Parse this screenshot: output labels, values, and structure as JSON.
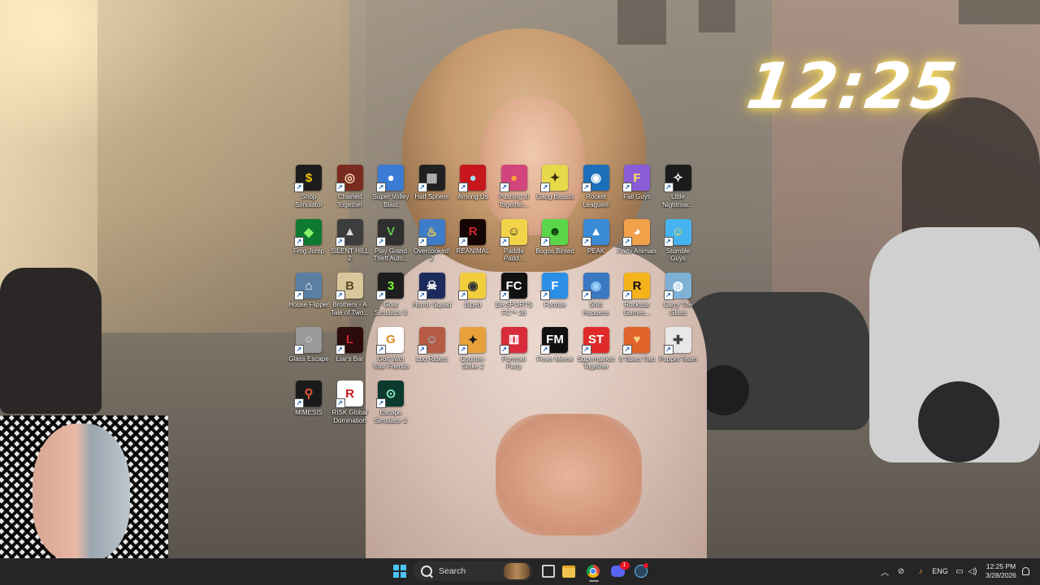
{
  "clock_widget": {
    "time": "12:25"
  },
  "desktop_icons": [
    {
      "label": "Shop Simulator",
      "color": "#1c1c1c",
      "glyph": "$",
      "glyph_color": "#f7c400"
    },
    {
      "label": "Chained Together",
      "color": "#7a2a1e",
      "glyph": "◎",
      "glyph_color": "#f0d9b5"
    },
    {
      "label": "Super Volley Blast",
      "color": "#3a7bd5",
      "glyph": "●",
      "glyph_color": "#ffffff"
    },
    {
      "label": "Half Sphere",
      "color": "#202020",
      "glyph": "▦",
      "glyph_color": "#bdbdbd"
    },
    {
      "label": "Among Us",
      "color": "#c8161d",
      "glyph": "●",
      "glyph_color": "#a7dcef"
    },
    {
      "label": "Pushing it! Together...",
      "color": "#d1457c",
      "glyph": "●",
      "glyph_color": "#f7a03a"
    },
    {
      "label": "Gang Beasts",
      "color": "#e6d94a",
      "glyph": "✦",
      "glyph_color": "#3a2d0c"
    },
    {
      "label": "Rocket League®",
      "color": "#1b6fb8",
      "glyph": "◉",
      "glyph_color": "#ffffff"
    },
    {
      "label": "Fall Guys",
      "color": "#8a5cd6",
      "glyph": "F",
      "glyph_color": "#ffe45c"
    },
    {
      "label": "Little Nightmar...",
      "color": "#1c1c1c",
      "glyph": "✧",
      "glyph_color": "#ffffff"
    },
    {
      "label": "Frog Jump",
      "color": "#0e7a2f",
      "glyph": "◆",
      "glyph_color": "#8bf26a"
    },
    {
      "label": "SILENT HILL 2",
      "color": "#3d3d3d",
      "glyph": "▲",
      "glyph_color": "#d9d9d9"
    },
    {
      "label": "Play Grand Theft Auto...",
      "color": "#2f2f2f",
      "glyph": "V",
      "glyph_color": "#5fc64b"
    },
    {
      "label": "Overcooked! 2",
      "color": "#3f7cc7",
      "glyph": "♨",
      "glyph_color": "#ffcf3f"
    },
    {
      "label": "REANIMAL",
      "color": "#150505",
      "glyph": "R",
      "glyph_color": "#d6242c"
    },
    {
      "label": "Paddle Padd...",
      "color": "#f3d34a",
      "glyph": "☺",
      "glyph_color": "#222222"
    },
    {
      "label": "Bogos Binted",
      "color": "#5bd64a",
      "glyph": "☻",
      "glyph_color": "#0b3d0b"
    },
    {
      "label": "PEAK",
      "color": "#3a8ad6",
      "glyph": "▲",
      "glyph_color": "#ffffff"
    },
    {
      "label": "Party Animals",
      "color": "#f0a14a",
      "glyph": "◕",
      "glyph_color": "#ffffff"
    },
    {
      "label": "Stumble Guys",
      "color": "#46b3f0",
      "glyph": "☺",
      "glyph_color": "#ffde3f"
    },
    {
      "label": "House Flipper",
      "color": "#5b7fa3",
      "glyph": "⌂",
      "glyph_color": "#ffffff"
    },
    {
      "label": "Brothers - A Tale of Two...",
      "color": "#d9c79b",
      "glyph": "B",
      "glyph_color": "#5a4a2a"
    },
    {
      "label": "Goat Simulator 3",
      "color": "#1e1e1e",
      "glyph": "3",
      "glyph_color": "#7dff3a"
    },
    {
      "label": "Horror Squad",
      "color": "#1d2a5c",
      "glyph": "☠",
      "glyph_color": "#ffffff"
    },
    {
      "label": "Biped",
      "color": "#f2cd3c",
      "glyph": "◉",
      "glyph_color": "#333333"
    },
    {
      "label": "EA SPORTS FC™ 26",
      "color": "#111111",
      "glyph": "FC",
      "glyph_color": "#ffffff"
    },
    {
      "label": "Fortnite",
      "color": "#2c8fe6",
      "glyph": "F",
      "glyph_color": "#ffffff"
    },
    {
      "label": "Shift Happens",
      "color": "#3b78c2",
      "glyph": "◉",
      "glyph_color": "#9ad1ff"
    },
    {
      "label": "Rockstar Games...",
      "color": "#f4b21b",
      "glyph": "R",
      "glyph_color": "#111111"
    },
    {
      "label": "Carry The Glass",
      "color": "#7fb0d6",
      "glyph": "◍",
      "glyph_color": "#ffffff"
    },
    {
      "label": "Glass Escape",
      "color": "#9a9a9a",
      "glyph": "○",
      "glyph_color": "#e5e5e5"
    },
    {
      "label": "Liar's Bar",
      "color": "#2b0b0b",
      "glyph": "L",
      "glyph_color": "#d0282e"
    },
    {
      "label": "Golf With Your Friends",
      "color": "#ffffff",
      "glyph": "G",
      "glyph_color": "#e08a1e"
    },
    {
      "label": "Log Riders",
      "color": "#b65a43",
      "glyph": "☺",
      "glyph_color": "#8fd0f2"
    },
    {
      "label": "Counter-Strike 2",
      "color": "#e8a03a",
      "glyph": "✦",
      "glyph_color": "#1a1a1a"
    },
    {
      "label": "Pummel Party",
      "color": "#d82c3c",
      "glyph": "⚅",
      "glyph_color": "#ffffff"
    },
    {
      "label": "Fever Meme",
      "color": "#111111",
      "glyph": "FM",
      "glyph_color": "#ffffff"
    },
    {
      "label": "Supermarket Together",
      "color": "#e02a2a",
      "glyph": "ST",
      "glyph_color": "#ffffff"
    },
    {
      "label": "It Takes Two",
      "color": "#e0632b",
      "glyph": "♥",
      "glyph_color": "#f7d18a"
    },
    {
      "label": "Puppet Team",
      "color": "#e8e8e8",
      "glyph": "✚",
      "glyph_color": "#444444"
    },
    {
      "label": "MIMESIS",
      "color": "#1a1a1a",
      "glyph": "⚲",
      "glyph_color": "#e85a35"
    },
    {
      "label": "RISK Global Domination",
      "color": "#ffffff",
      "glyph": "R",
      "glyph_color": "#c3171d"
    },
    {
      "label": "Escape Simulator 2",
      "color": "#0d3a2f",
      "glyph": "⊙",
      "glyph_color": "#8ef0c5"
    }
  ],
  "taskbar": {
    "search_label": "Search",
    "tray": {
      "language": "ENG",
      "time": "12:25 PM",
      "date": "3/28/2026",
      "discord_badge": "1"
    }
  }
}
